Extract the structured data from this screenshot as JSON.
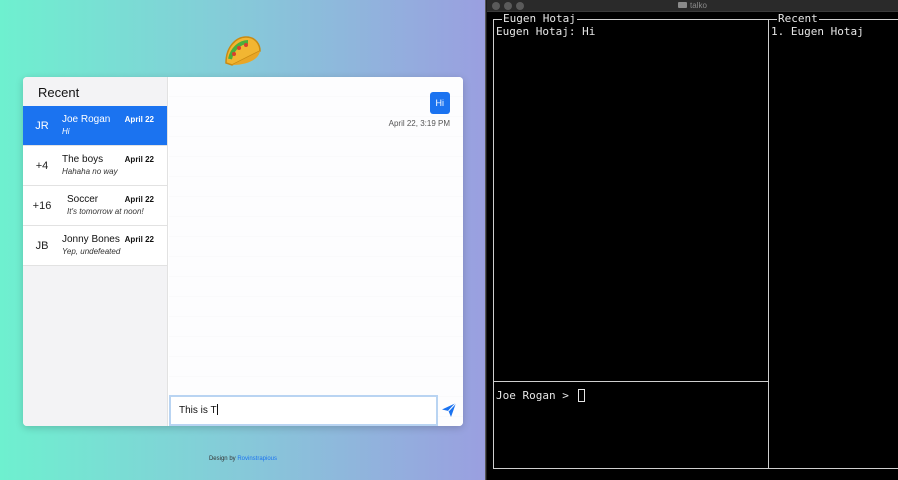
{
  "web": {
    "sidebar_title": "Recent",
    "conversations": [
      {
        "avatar": "JR",
        "name": "Joe Rogan",
        "date": "April 22",
        "preview": "Hi"
      },
      {
        "avatar": "+4",
        "name": "The boys",
        "date": "April 22",
        "preview": "Hahaha no way"
      },
      {
        "avatar": "+16",
        "name": "Soccer",
        "date": "April 22",
        "preview": "It's tomorrow at noon!"
      },
      {
        "avatar": "JB",
        "name": "Jonny Bones",
        "date": "April 22",
        "preview": "Yep, undefeated"
      }
    ],
    "message": {
      "text": "Hi",
      "time": "April 22, 3:19 PM"
    },
    "composer_value": "This is T",
    "footer_prefix": "Design by ",
    "footer_link": "Rovinstrapious",
    "accent_color": "#1b73f0",
    "logo_icon": "taco-icon",
    "send_icon": "paper-plane-icon"
  },
  "terminal": {
    "window_title": "talko",
    "chat_title": "Eugen Hotaj",
    "chat_line": "Eugen Hotaj: Hi",
    "recent_title": "Recent",
    "recent_line": "1. Eugen Hotaj",
    "prompt": "Joe Rogan > "
  }
}
